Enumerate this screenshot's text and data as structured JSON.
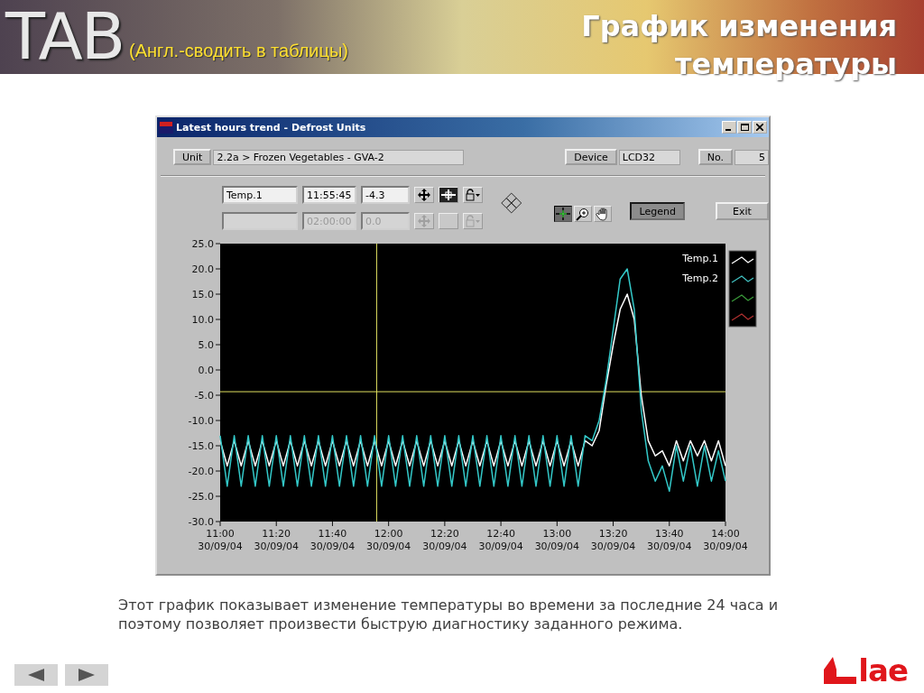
{
  "slide": {
    "logo_text": "TAB",
    "subtitle": "(Англ.-сводить в таблицы)",
    "title": "График изменения температуры"
  },
  "window": {
    "title": "Latest hours trend - Defrost Units"
  },
  "info_row": [
    {
      "label": "Unit",
      "value": "2.2a > Frozen Vegetables - GVA-2"
    },
    {
      "label": "Device",
      "value": "LCD32"
    },
    {
      "label": "No.",
      "value": "5"
    }
  ],
  "cursors": [
    {
      "name": "Temp.1",
      "time": "11:55:45",
      "value": "-4.3",
      "disabled": false
    },
    {
      "time": "02:00:00",
      "value": "0.0",
      "disabled": true
    }
  ],
  "tools": [
    {
      "kind": "crosshair",
      "selected": true
    },
    {
      "kind": "zoom",
      "selected": false
    },
    {
      "kind": "pan",
      "selected": false
    }
  ],
  "buttons": [
    {
      "label": "Legend",
      "pressed": true
    },
    {
      "label": "Exit",
      "pressed": false
    }
  ],
  "chart_data": {
    "type": "line",
    "legend": "upper right",
    "ylim": [
      -30,
      25
    ],
    "categories": [
      "11:00\n30/09/04",
      null,
      null,
      null,
      null,
      null,
      null,
      null,
      "11:20\n30/09/04",
      null,
      null,
      null,
      null,
      null,
      null,
      null,
      "11:40\n30/09/04",
      null,
      null,
      null,
      null,
      null,
      null,
      null,
      "12:00\n30/09/04",
      null,
      null,
      null,
      null,
      null,
      null,
      null,
      "12:20\n30/09/04",
      null,
      null,
      null,
      null,
      null,
      null,
      null,
      "12:40\n30/09/04",
      null,
      null,
      null,
      null,
      null,
      null,
      null,
      "13:00\n30/09/04",
      null,
      null,
      null,
      null,
      null,
      null,
      null,
      "13:20\n30/09/04",
      null,
      null,
      null,
      null,
      null,
      null,
      null,
      "13:40\n30/09/04",
      null,
      null,
      null,
      null,
      null,
      null,
      null,
      "14:00\n30/09/04"
    ],
    "yticks": [
      {
        "value": 25,
        "label": "25.0"
      },
      {
        "value": 20,
        "label": "20.0"
      },
      {
        "value": 15,
        "label": "15.0"
      },
      {
        "value": 10,
        "label": "10.0"
      },
      {
        "value": 5,
        "label": "5.0"
      },
      {
        "value": 0,
        "label": "0.0"
      },
      {
        "value": -5,
        "label": "-5.0"
      },
      {
        "value": -10,
        "label": "-10.0"
      },
      {
        "value": -15,
        "label": "-15.0"
      },
      {
        "value": -20,
        "label": "-20.0"
      },
      {
        "value": -25,
        "label": "-25.0"
      },
      {
        "value": -30,
        "label": "-30.0"
      }
    ],
    "series": [
      {
        "name": "Temp.1",
        "color": "#ffffff",
        "values": [
          -14,
          -19,
          -14,
          -19,
          -14,
          -19,
          -14,
          -19,
          -14,
          -19,
          -14,
          -19,
          -14,
          -19,
          -14,
          -19,
          -14,
          -19,
          -14,
          -19,
          -14,
          -19,
          -14,
          -19,
          -14,
          -19,
          -14,
          -19,
          -14,
          -19,
          -14,
          -19,
          -14,
          -19,
          -14,
          -19,
          -14,
          -19,
          -14,
          -19,
          -14,
          -19,
          -14,
          -19,
          -14,
          -19,
          -14,
          -19,
          -14,
          -19,
          -14,
          -19,
          -14,
          -15,
          -12,
          -3,
          5,
          12,
          15,
          10,
          -5,
          -14,
          -17,
          -16,
          -19,
          -14,
          -18,
          -14,
          -17,
          -14,
          -18,
          -14,
          -19
        ]
      },
      {
        "name": "Temp.2",
        "color": "#33c8c8",
        "values": [
          -13,
          -23,
          -13,
          -23,
          -13,
          -23,
          -13,
          -23,
          -13,
          -23,
          -13,
          -23,
          -13,
          -23,
          -13,
          -23,
          -13,
          -23,
          -13,
          -23,
          -13,
          -23,
          -13,
          -23,
          -13,
          -23,
          -13,
          -23,
          -13,
          -23,
          -13,
          -23,
          -13,
          -23,
          -13,
          -23,
          -13,
          -23,
          -13,
          -23,
          -13,
          -23,
          -13,
          -23,
          -13,
          -23,
          -13,
          -23,
          -13,
          -23,
          -13,
          -23,
          -13,
          -14,
          -10,
          -2,
          8,
          18,
          20,
          12,
          -8,
          -18,
          -22,
          -19,
          -24,
          -15,
          -22,
          -15,
          -23,
          -15,
          -22,
          -16,
          -22
        ]
      }
    ],
    "ref_lines": [
      {
        "axis": "y",
        "value": -4.3,
        "color": "#e0e060"
      }
    ]
  },
  "plot_legend": [
    {
      "color": "#ffffff"
    },
    {
      "color": "#40c0c0"
    },
    {
      "color": "#3a9a3a"
    },
    {
      "color": "#b03030"
    }
  ],
  "caption": "Этот график показывает изменение температуры во времени за последние 24 часа и поэтому позволяет произвести быструю диагностику заданного режима.",
  "brand": "lae"
}
